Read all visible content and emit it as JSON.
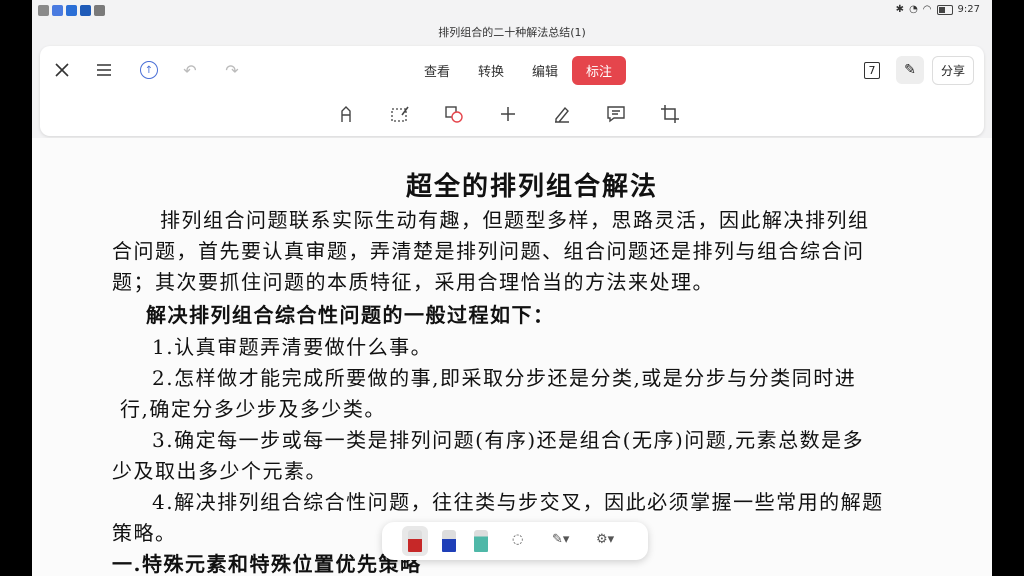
{
  "status": {
    "time": "9:27"
  },
  "document": {
    "title": "排列组合的二十种解法总结(1)"
  },
  "toolbar": {
    "tabs": [
      {
        "label": "查看",
        "active": false
      },
      {
        "label": "转换",
        "active": false
      },
      {
        "label": "编辑",
        "active": false
      },
      {
        "label": "标注",
        "active": true
      }
    ],
    "page_count": "7",
    "share_label": "分享",
    "accent_color": "#e5454c"
  },
  "page": {
    "heading": "超全的排列组合解法",
    "lines": [
      "排列组合问题联系实际生动有趣，但题型多样，思路灵活，因此解决排列组",
      "合问题，首先要认真审题，弄清楚是排列问题、组合问题还是排列与组合综合问",
      "题；其次要抓住问题的本质特征，采用合理恰当的方法来处理。",
      "解决排列组合综合性问题的一般过程如下：",
      "1.认真审题弄清要做什么事。",
      "2.怎样做才能完成所要做的事,即采取分步还是分类,或是分步与分类同时进",
      "行,确定分多少步及多少类。",
      "3.确定每一步或每一类是排列问题(有序)还是组合(无序)问题,元素总数是多",
      "少及取出多少个元素。",
      "4.解决排列组合综合性问题，往往类与步交叉，因此必须掌握一些常用的解题",
      "策略。",
      "一.特殊元素和特殊位置优先策略"
    ]
  }
}
